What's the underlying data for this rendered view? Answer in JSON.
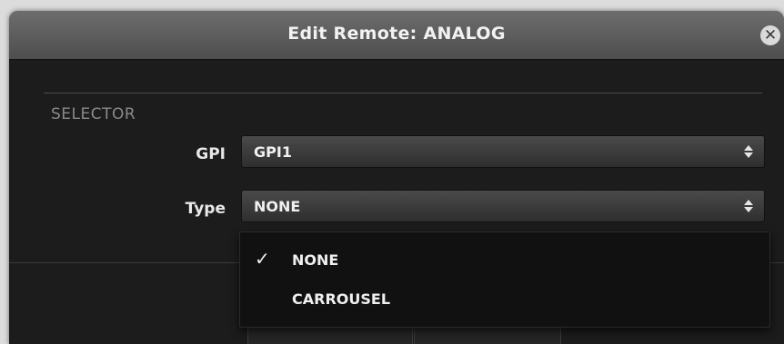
{
  "dialog": {
    "title": "Edit Remote: ANALOG",
    "close_icon": "close-icon"
  },
  "selector": {
    "section_label": "SELECTOR",
    "gpi": {
      "label": "GPI",
      "value": "GPI1"
    },
    "type": {
      "label": "Type",
      "value": "NONE"
    }
  },
  "dropdown": {
    "items": [
      {
        "label": "NONE",
        "checked": true,
        "check_glyph": "✓"
      },
      {
        "label": "CARROUSEL",
        "checked": false
      }
    ]
  }
}
